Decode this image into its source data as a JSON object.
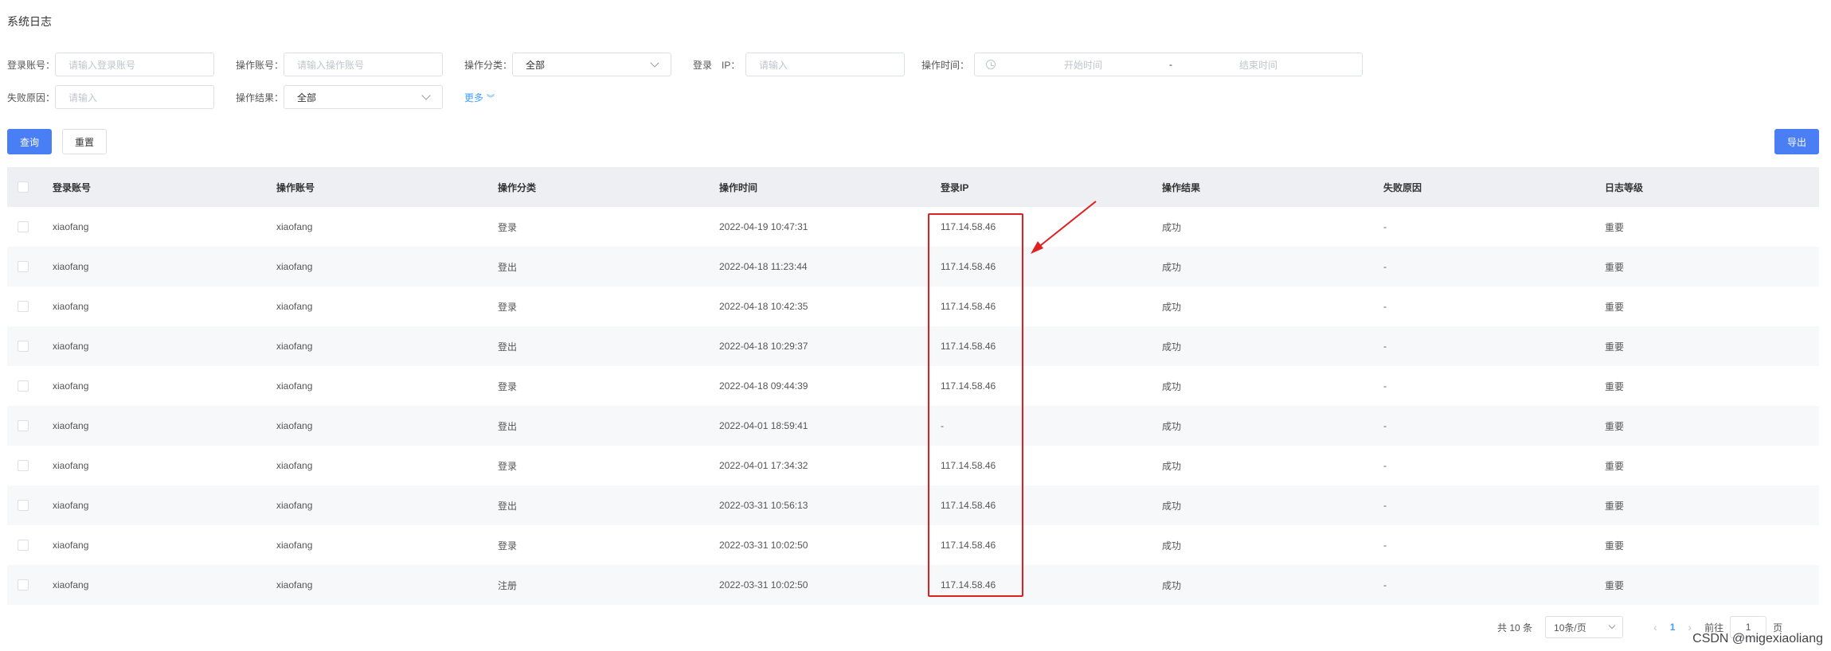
{
  "page": {
    "title": "系统日志"
  },
  "filters": {
    "login_account": {
      "label": "登录账号：",
      "placeholder": "请输入登录账号"
    },
    "op_account": {
      "label": "操作账号：",
      "placeholder": "请输入操作账号"
    },
    "op_category": {
      "label": "操作分类：",
      "value": "全部"
    },
    "login_ip": {
      "label": "登录　IP：",
      "placeholder": "请输入"
    },
    "op_time": {
      "label": "操作时间：",
      "start_placeholder": "开始时间",
      "separator": "-",
      "end_placeholder": "结束时间"
    },
    "fail_reason": {
      "label": "失败原因：",
      "placeholder": "请输入"
    },
    "op_result": {
      "label": "操作结果：",
      "value": "全部"
    },
    "more_label": "更多",
    "more_icon": "chevron-double-down-icon"
  },
  "actions": {
    "query": "查询",
    "reset": "重置",
    "export": "导出"
  },
  "table": {
    "columns": [
      "登录账号",
      "操作账号",
      "操作分类",
      "操作时间",
      "登录IP",
      "操作结果",
      "失败原因",
      "日志等级"
    ],
    "rows": [
      [
        "xiaofang",
        "xiaofang",
        "登录",
        "2022-04-19 10:47:31",
        "117.14.58.46",
        "成功",
        "-",
        "重要"
      ],
      [
        "xiaofang",
        "xiaofang",
        "登出",
        "2022-04-18 11:23:44",
        "117.14.58.46",
        "成功",
        "-",
        "重要"
      ],
      [
        "xiaofang",
        "xiaofang",
        "登录",
        "2022-04-18 10:42:35",
        "117.14.58.46",
        "成功",
        "-",
        "重要"
      ],
      [
        "xiaofang",
        "xiaofang",
        "登出",
        "2022-04-18 10:29:37",
        "117.14.58.46",
        "成功",
        "-",
        "重要"
      ],
      [
        "xiaofang",
        "xiaofang",
        "登录",
        "2022-04-18 09:44:39",
        "117.14.58.46",
        "成功",
        "-",
        "重要"
      ],
      [
        "xiaofang",
        "xiaofang",
        "登出",
        "2022-04-01 18:59:41",
        "-",
        "成功",
        "-",
        "重要"
      ],
      [
        "xiaofang",
        "xiaofang",
        "登录",
        "2022-04-01 17:34:32",
        "117.14.58.46",
        "成功",
        "-",
        "重要"
      ],
      [
        "xiaofang",
        "xiaofang",
        "登出",
        "2022-03-31 10:56:13",
        "117.14.58.46",
        "成功",
        "-",
        "重要"
      ],
      [
        "xiaofang",
        "xiaofang",
        "登录",
        "2022-03-31 10:02:50",
        "117.14.58.46",
        "成功",
        "-",
        "重要"
      ],
      [
        "xiaofang",
        "xiaofang",
        "注册",
        "2022-03-31 10:02:50",
        "117.14.58.46",
        "成功",
        "-",
        "重要"
      ]
    ]
  },
  "pagination": {
    "total": "共 10 条",
    "page_size": "10条/页",
    "current_page": "1",
    "goto_prefix": "前往",
    "goto_value": "1",
    "goto_suffix": "页"
  },
  "annotation": {
    "color": "#e02020"
  },
  "watermark": "CSDN @migexiaoliang",
  "colors": {
    "primary": "#4a7ef5",
    "header_bg": "#eeeff2",
    "link": "#409eff"
  }
}
